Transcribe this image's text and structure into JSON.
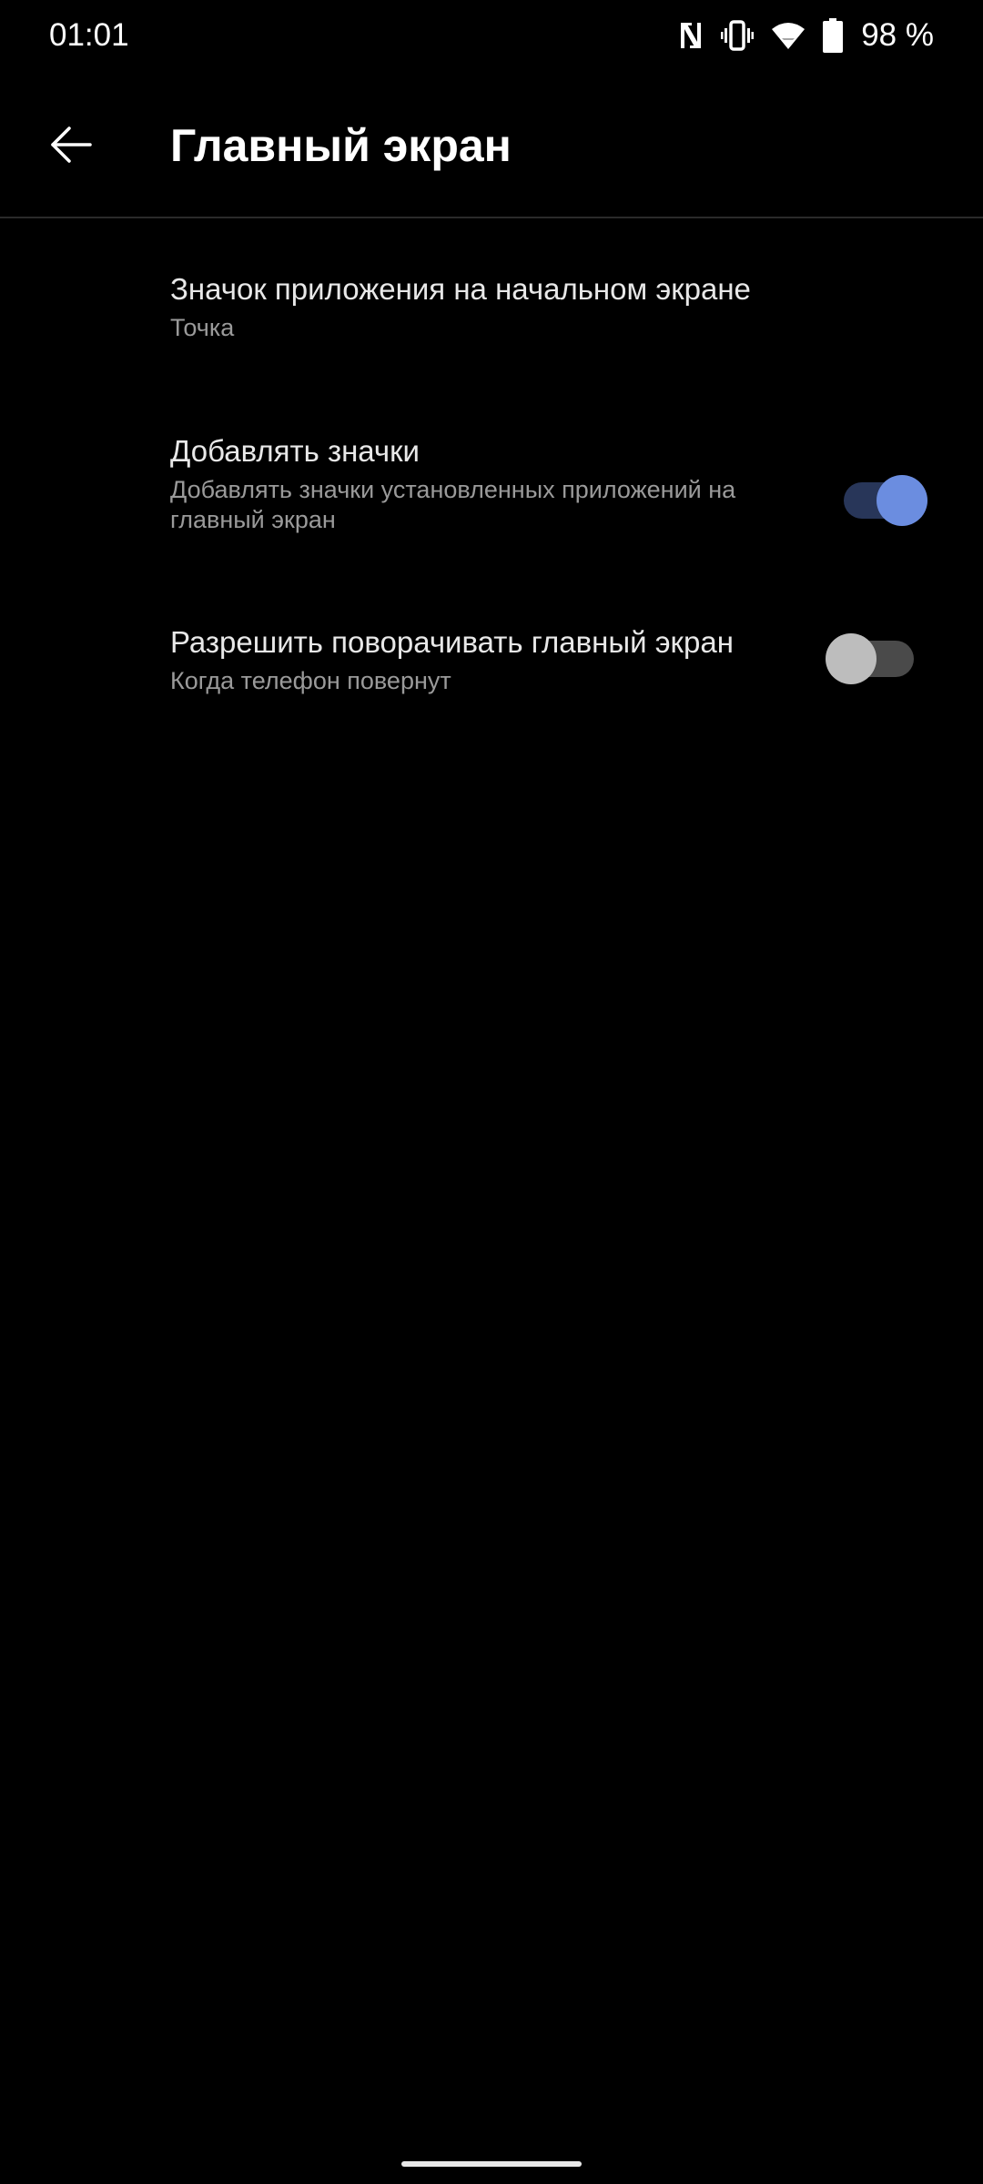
{
  "status_bar": {
    "time": "01:01",
    "battery_percent": "98 %",
    "icons": [
      "nfc-icon",
      "vibrate-icon",
      "wifi-icon",
      "battery-icon"
    ]
  },
  "app_bar": {
    "back_icon": "arrow-back-icon",
    "title": "Главный экран"
  },
  "settings": {
    "app_icon": {
      "title": "Значок приложения на начальном экране",
      "summary": "Точка"
    },
    "add_icons": {
      "title": "Добавлять значки",
      "summary": "Добавлять значки установленных приложений на главный экран",
      "enabled": true
    },
    "rotate": {
      "title": "Разрешить поворачивать главный экран",
      "summary": "Когда телефон повернут",
      "enabled": false
    }
  },
  "colors": {
    "background": "#000000",
    "accent": "#6b8de0",
    "accent_track": "#283659",
    "switch_off_thumb": "#bdbdbd",
    "switch_off_track": "#4a4a4a",
    "secondary_text": "#9a9a9a"
  }
}
